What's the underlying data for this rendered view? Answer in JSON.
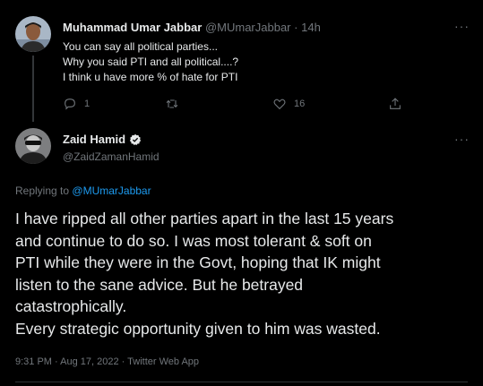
{
  "reply": {
    "author_name": "Muhammad Umar Jabbar",
    "author_handle": "@MUmarJabbar",
    "separator": "·",
    "time": "14h",
    "lines": [
      "You can say all political parties...",
      "Why you said PTI and all political....?",
      "I think u have more % of hate for PTI"
    ],
    "reply_count": "1",
    "like_count": "16",
    "icons": [
      "reply-icon",
      "retweet-icon",
      "like-icon",
      "share-icon"
    ]
  },
  "tweet": {
    "author_name": "Zaid Hamid",
    "author_handle": "@ZaidZamanHamid",
    "verified": true,
    "replying_prefix": "Replying to",
    "replying_handle": "@MUmarJabbar",
    "lines": [
      "I have ripped all other parties apart in the last 15 years",
      "and continue to do so. I was most tolerant & soft on",
      "PTI while they were in the Govt, hoping that IK might",
      "listen to the sane advice. But he betrayed",
      "catastrophically.",
      "Every strategic opportunity given to him was wasted."
    ],
    "meta": "9:31 PM · Aug 17, 2022 · Twitter Web App"
  },
  "more_glyph": "···",
  "colors": {
    "background": "#000000",
    "text": "#e7e9ea",
    "muted": "#71767b",
    "link": "#1d9bf0",
    "verified": "#e7e9ea"
  }
}
